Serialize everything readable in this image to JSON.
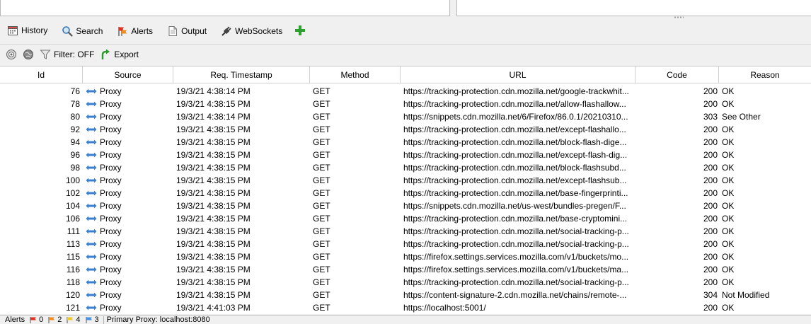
{
  "tabs": [
    {
      "label": "History",
      "icon": "calendar-icon",
      "active": true
    },
    {
      "label": "Search",
      "icon": "magnifier-icon",
      "active": false
    },
    {
      "label": "Alerts",
      "icon": "flags-icon",
      "active": false
    },
    {
      "label": "Output",
      "icon": "document-icon",
      "active": false
    },
    {
      "label": "WebSockets",
      "icon": "plug-icon",
      "active": false
    }
  ],
  "add_tab": {
    "icon": "plus-icon",
    "color": "#2ca02c"
  },
  "toolbar": {
    "filter_label": "Filter: OFF",
    "export_label": "Export"
  },
  "columns": [
    "Id",
    "Source",
    "Req. Timestamp",
    "Method",
    "URL",
    "Code",
    "Reason"
  ],
  "rows": [
    {
      "id": "76",
      "source": "Proxy",
      "ts": "19/3/21 4:38:14 PM",
      "method": "GET",
      "url": "https://tracking-protection.cdn.mozilla.net/google-trackwhit...",
      "code": "200",
      "reason": "OK"
    },
    {
      "id": "78",
      "source": "Proxy",
      "ts": "19/3/21 4:38:15 PM",
      "method": "GET",
      "url": "https://tracking-protection.cdn.mozilla.net/allow-flashallow...",
      "code": "200",
      "reason": "OK"
    },
    {
      "id": "80",
      "source": "Proxy",
      "ts": "19/3/21 4:38:14 PM",
      "method": "GET",
      "url": "https://snippets.cdn.mozilla.net/6/Firefox/86.0.1/20210310...",
      "code": "303",
      "reason": "See Other"
    },
    {
      "id": "92",
      "source": "Proxy",
      "ts": "19/3/21 4:38:15 PM",
      "method": "GET",
      "url": "https://tracking-protection.cdn.mozilla.net/except-flashallo...",
      "code": "200",
      "reason": "OK"
    },
    {
      "id": "94",
      "source": "Proxy",
      "ts": "19/3/21 4:38:15 PM",
      "method": "GET",
      "url": "https://tracking-protection.cdn.mozilla.net/block-flash-dige...",
      "code": "200",
      "reason": "OK"
    },
    {
      "id": "96",
      "source": "Proxy",
      "ts": "19/3/21 4:38:15 PM",
      "method": "GET",
      "url": "https://tracking-protection.cdn.mozilla.net/except-flash-dig...",
      "code": "200",
      "reason": "OK"
    },
    {
      "id": "98",
      "source": "Proxy",
      "ts": "19/3/21 4:38:15 PM",
      "method": "GET",
      "url": "https://tracking-protection.cdn.mozilla.net/block-flashsubd...",
      "code": "200",
      "reason": "OK"
    },
    {
      "id": "100",
      "source": "Proxy",
      "ts": "19/3/21 4:38:15 PM",
      "method": "GET",
      "url": "https://tracking-protection.cdn.mozilla.net/except-flashsub...",
      "code": "200",
      "reason": "OK"
    },
    {
      "id": "102",
      "source": "Proxy",
      "ts": "19/3/21 4:38:15 PM",
      "method": "GET",
      "url": "https://tracking-protection.cdn.mozilla.net/base-fingerprinti...",
      "code": "200",
      "reason": "OK"
    },
    {
      "id": "104",
      "source": "Proxy",
      "ts": "19/3/21 4:38:15 PM",
      "method": "GET",
      "url": "https://snippets.cdn.mozilla.net/us-west/bundles-pregen/F...",
      "code": "200",
      "reason": "OK"
    },
    {
      "id": "106",
      "source": "Proxy",
      "ts": "19/3/21 4:38:15 PM",
      "method": "GET",
      "url": "https://tracking-protection.cdn.mozilla.net/base-cryptomini...",
      "code": "200",
      "reason": "OK"
    },
    {
      "id": "111",
      "source": "Proxy",
      "ts": "19/3/21 4:38:15 PM",
      "method": "GET",
      "url": "https://tracking-protection.cdn.mozilla.net/social-tracking-p...",
      "code": "200",
      "reason": "OK"
    },
    {
      "id": "113",
      "source": "Proxy",
      "ts": "19/3/21 4:38:15 PM",
      "method": "GET",
      "url": "https://tracking-protection.cdn.mozilla.net/social-tracking-p...",
      "code": "200",
      "reason": "OK"
    },
    {
      "id": "115",
      "source": "Proxy",
      "ts": "19/3/21 4:38:15 PM",
      "method": "GET",
      "url": "https://firefox.settings.services.mozilla.com/v1/buckets/mo...",
      "code": "200",
      "reason": "OK"
    },
    {
      "id": "116",
      "source": "Proxy",
      "ts": "19/3/21 4:38:15 PM",
      "method": "GET",
      "url": "https://firefox.settings.services.mozilla.com/v1/buckets/ma...",
      "code": "200",
      "reason": "OK"
    },
    {
      "id": "118",
      "source": "Proxy",
      "ts": "19/3/21 4:38:15 PM",
      "method": "GET",
      "url": "https://tracking-protection.cdn.mozilla.net/social-tracking-p...",
      "code": "200",
      "reason": "OK"
    },
    {
      "id": "120",
      "source": "Proxy",
      "ts": "19/3/21 4:38:15 PM",
      "method": "GET",
      "url": "https://content-signature-2.cdn.mozilla.net/chains/remote-...",
      "code": "304",
      "reason": "Not Modified"
    },
    {
      "id": "121",
      "source": "Proxy",
      "ts": "19/3/21 4:41:03 PM",
      "method": "GET",
      "url": "https://localhost:5001/",
      "code": "200",
      "reason": "OK"
    }
  ],
  "statusbar": {
    "alerts_label": "Alerts",
    "high_count": "0",
    "medium_count": "2",
    "low_count": "4",
    "info_count": "3",
    "proxy_text": "Primary Proxy: localhost:8080",
    "colors": {
      "high": "#e03020",
      "medium": "#f08c20",
      "low": "#f0c820",
      "info": "#4a90e0"
    }
  }
}
